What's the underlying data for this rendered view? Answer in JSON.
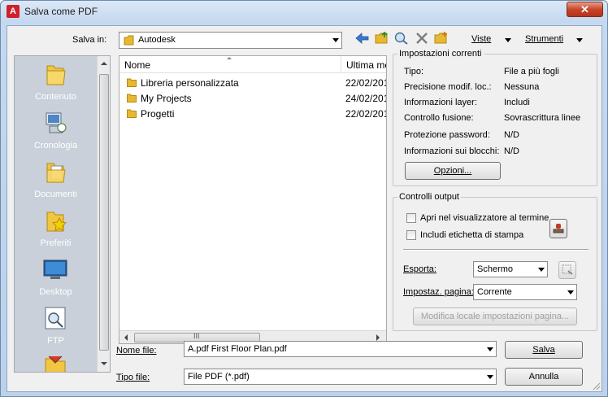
{
  "window": {
    "title": "Salva come PDF",
    "close_symbol": "✕"
  },
  "toolbar": {
    "save_in_label": "Salva in:",
    "save_in_value": "Autodesk",
    "views_label": "Viste",
    "tools_label": "Strumenti"
  },
  "places": [
    {
      "label": "Contenuto",
      "icon": "folder-icon"
    },
    {
      "label": "Cronologia",
      "icon": "history-icon"
    },
    {
      "label": "Documenti",
      "icon": "documents-icon"
    },
    {
      "label": "Preferiti",
      "icon": "favorites-icon"
    },
    {
      "label": "Desktop",
      "icon": "desktop-icon"
    },
    {
      "label": "FTP",
      "icon": "ftp-icon"
    }
  ],
  "file_list": {
    "columns": [
      "Nome",
      "Ultima mo"
    ],
    "rows": [
      {
        "name": "Libreria personalizzata",
        "date": "22/02/201"
      },
      {
        "name": "My Projects",
        "date": "24/02/201"
      },
      {
        "name": "Progetti",
        "date": "22/02/201"
      }
    ],
    "hscroll_grip": "III"
  },
  "current_settings": {
    "title": "Impostazioni correnti",
    "rows": [
      {
        "label": "Tipo:",
        "value": "File a più fogli"
      },
      {
        "label": "Precisione modif. loc.:",
        "value": "Nessuna"
      },
      {
        "label": "Informazioni layer:",
        "value": "Includi"
      },
      {
        "label": "Controllo fusione:",
        "value": "Sovrascrittura linee"
      },
      {
        "label": "Protezione password:",
        "value": "N/D"
      },
      {
        "label": "Informazioni sui blocchi:",
        "value": "N/D"
      }
    ],
    "options_button": "Opzioni..."
  },
  "output_controls": {
    "title": "Controlli output",
    "open_viewer": "Apri nel visualizzatore al termine",
    "include_plot_stamp": "Includi etichetta di stampa",
    "export_label": "Esporta:",
    "export_value": "Schermo",
    "page_setup_label": "Impostaz. pagina:",
    "page_setup_value": "Corrente",
    "modify_page_setup": "Modifica locale impostazioni pagina..."
  },
  "bottom": {
    "file_name_label": "Nome file:",
    "file_name_value": "A.pdf First Floor Plan.pdf",
    "file_type_label": "Tipo file:",
    "file_type_value": "File PDF (*.pdf)",
    "save_button": "Salva",
    "cancel_button": "Annulla"
  }
}
